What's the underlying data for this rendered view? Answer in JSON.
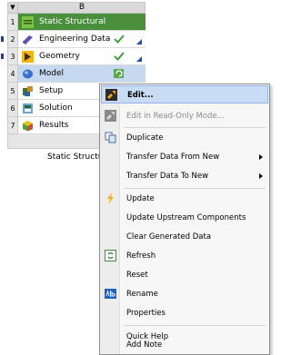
{
  "system": {
    "column_header": "B",
    "caption": "Static Structural",
    "rows": [
      {
        "num": "1",
        "label": "Static Structural",
        "icon": "static-structural-icon"
      },
      {
        "num": "2",
        "label": "Engineering Data",
        "icon": "engineering-data-icon",
        "status": "check"
      },
      {
        "num": "3",
        "label": "Geometry",
        "icon": "geometry-icon",
        "status": "check"
      },
      {
        "num": "4",
        "label": "Model",
        "icon": "model-icon",
        "status": "refresh"
      },
      {
        "num": "5",
        "label": "Setup",
        "icon": "setup-icon"
      },
      {
        "num": "6",
        "label": "Solution",
        "icon": "solution-icon"
      },
      {
        "num": "7",
        "label": "Results",
        "icon": "results-icon"
      }
    ]
  },
  "context_menu": {
    "items": [
      {
        "label": "Edit...",
        "icon": "edit-icon"
      },
      {
        "label": "Edit in Read-Only Mode...",
        "icon": "edit-readonly-icon"
      },
      {
        "label": "Duplicate",
        "icon": "duplicate-icon"
      },
      {
        "label": "Transfer Data From New"
      },
      {
        "label": "Transfer Data To New"
      },
      {
        "label": "Update",
        "icon": "update-icon"
      },
      {
        "label": "Update Upstream Components"
      },
      {
        "label": "Clear Generated Data"
      },
      {
        "label": "Refresh",
        "icon": "refresh-icon"
      },
      {
        "label": "Reset"
      },
      {
        "label": "Rename",
        "icon": "rename-icon"
      },
      {
        "label": "Properties"
      },
      {
        "label": "Quick Help"
      },
      {
        "label": "Add Note"
      }
    ]
  }
}
